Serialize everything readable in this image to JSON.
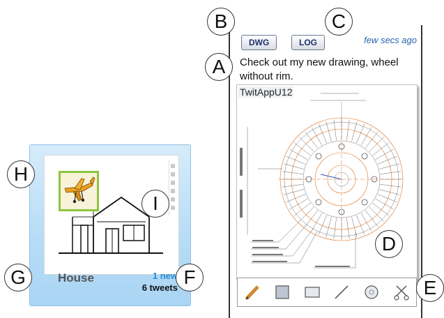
{
  "tile": {
    "title": "House",
    "new_count": "1 new",
    "tweet_count": "6 tweets"
  },
  "panel": {
    "dwg_button": "DWG",
    "log_button": "LOG",
    "timestamp": "few secs ago",
    "tweet_text": "Check out my new drawing, wheel without rim.",
    "drawing_label": "TwitAppU12"
  },
  "callouts": {
    "a": "A",
    "b": "B",
    "c": "C",
    "d": "D",
    "e": "E",
    "f": "F",
    "g": "G",
    "h": "H",
    "i": "I"
  },
  "toolbar_icons": [
    "pencil-icon",
    "rectangle-filled-icon",
    "rectangle-icon",
    "line-icon",
    "circle-icon",
    "scissors-icon"
  ],
  "colors": {
    "tile_bg": "#b6dcf6",
    "new_count": "#2a8ad4",
    "timestamp": "#2764b4",
    "thumbnail_border": "#8cc63f",
    "drawing_orange": "#e07020"
  }
}
